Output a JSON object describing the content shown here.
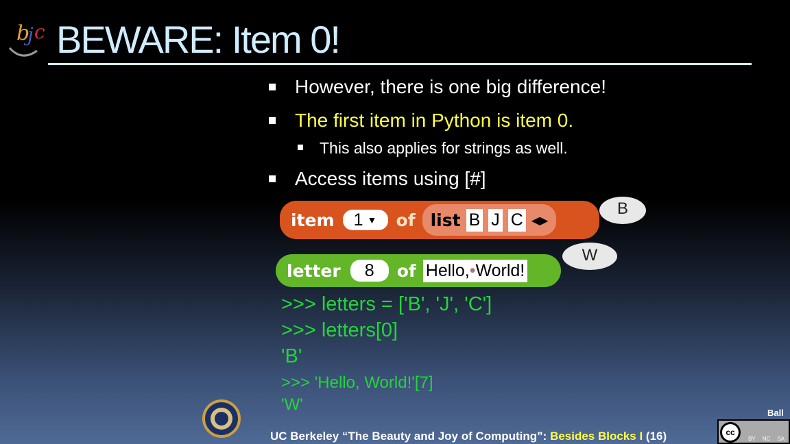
{
  "title": "BEWARE: Item 0!",
  "logo": "bjc",
  "bullets": [
    {
      "text": "However, there is one big difference!",
      "color": "#ffffff"
    },
    {
      "text": "The first item in Python is item 0.",
      "color": "#ffff44"
    },
    {
      "text": "This also applies for strings as well.",
      "color": "#ffffff"
    },
    {
      "text": "Access items using [#]",
      "color": "#ffffff"
    }
  ],
  "block1": {
    "op": "item",
    "index": "1",
    "of": "of",
    "list": "list",
    "items": [
      "B",
      "J",
      "C"
    ],
    "result": "B",
    "color": "#d9531e"
  },
  "block2": {
    "op": "letter",
    "index": "8",
    "of": "of",
    "text": "Hello,",
    "text2": "World!",
    "result": "W",
    "color": "#62b627"
  },
  "code": [
    ">>> letters = ['B', 'J', 'C']",
    ">>> letters[0]",
    "'B'",
    ">>> 'Hello, World!'[7]",
    "'W'"
  ],
  "footer": {
    "prefix": "UC Berkeley “The Beauty and Joy of Computing”: ",
    "course": "Besides Blocks I",
    "page": " (16)",
    "author": "Ball",
    "license": [
      "BY",
      "NC",
      "SA"
    ]
  }
}
